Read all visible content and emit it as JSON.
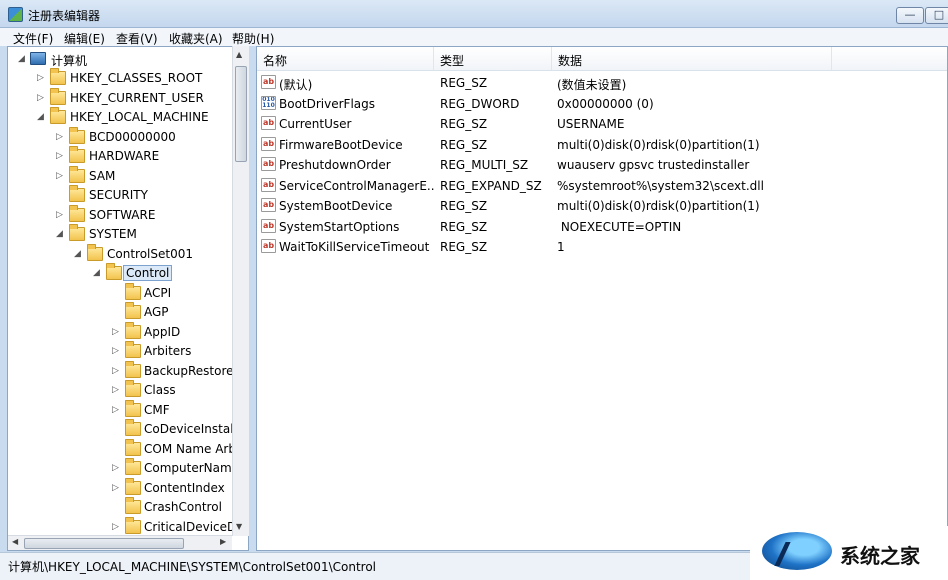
{
  "window": {
    "title": "注册表编辑器",
    "minimize": "—",
    "maximize": "□"
  },
  "menu": [
    "文件(F)",
    "编辑(E)",
    "查看(V)",
    "收藏夹(A)",
    "帮助(H)"
  ],
  "tree": {
    "root": "计算机",
    "items": [
      "HKEY_CLASSES_ROOT",
      "HKEY_CURRENT_USER",
      "HKEY_LOCAL_MACHINE",
      "BCD00000000",
      "HARDWARE",
      "SAM",
      "SECURITY",
      "SOFTWARE",
      "SYSTEM",
      "ControlSet001",
      "Control",
      "ACPI",
      "AGP",
      "AppID",
      "Arbiters",
      "BackupRestore",
      "Class",
      "CMF",
      "CoDeviceInstalle",
      "COM Name Arb",
      "ComputerName",
      "ContentIndex",
      "CrashControl",
      "CriticalDeviceDa"
    ]
  },
  "list": {
    "headers": {
      "name": "名称",
      "type": "类型",
      "data": "数据"
    },
    "rows": [
      {
        "icon": "string-value-icon",
        "name": "(默认)",
        "type": "REG_SZ",
        "data": "(数值未设置)"
      },
      {
        "icon": "binary-value-icon",
        "name": "BootDriverFlags",
        "type": "REG_DWORD",
        "data": "0x00000000 (0)"
      },
      {
        "icon": "string-value-icon",
        "name": "CurrentUser",
        "type": "REG_SZ",
        "data": "USERNAME"
      },
      {
        "icon": "string-value-icon",
        "name": "FirmwareBootDevice",
        "type": "REG_SZ",
        "data": "multi(0)disk(0)rdisk(0)partition(1)"
      },
      {
        "icon": "string-value-icon",
        "name": "PreshutdownOrder",
        "type": "REG_MULTI_SZ",
        "data": "wuauserv gpsvc trustedinstaller"
      },
      {
        "icon": "string-value-icon",
        "name": "ServiceControlManagerE...",
        "type": "REG_EXPAND_SZ",
        "data": "%systemroot%\\system32\\scext.dll"
      },
      {
        "icon": "string-value-icon",
        "name": "SystemBootDevice",
        "type": "REG_SZ",
        "data": "multi(0)disk(0)rdisk(0)partition(1)"
      },
      {
        "icon": "string-value-icon",
        "name": "SystemStartOptions",
        "type": "REG_SZ",
        "data": " NOEXECUTE=OPTIN"
      },
      {
        "icon": "string-value-icon",
        "name": "WaitToKillServiceTimeout",
        "type": "REG_SZ",
        "data": "1"
      }
    ]
  },
  "status": {
    "path": "计算机\\HKEY_LOCAL_MACHINE\\SYSTEM\\ControlSet001\\Control"
  },
  "watermark": {
    "text": "系统之家"
  }
}
